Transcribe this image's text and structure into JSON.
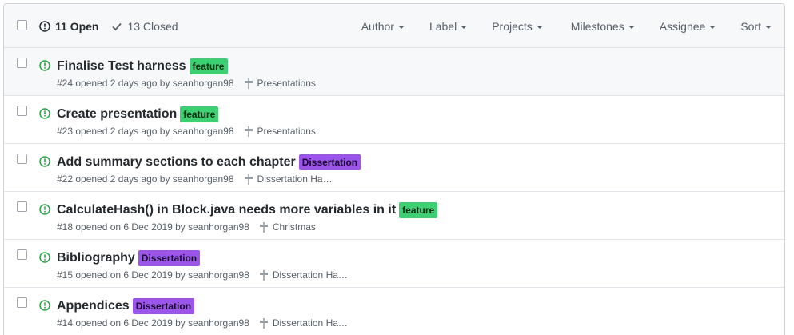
{
  "header": {
    "open_label": "11 Open",
    "closed_label": "13 Closed",
    "filters": [
      "Author",
      "Label",
      "Projects",
      "Milestones",
      "Assignee",
      "Sort"
    ]
  },
  "colors": {
    "open_icon": "#28a745",
    "feature": "#3ecf72",
    "dissertation": "#9b55e8"
  },
  "issues": [
    {
      "title": "Finalise Test harness",
      "label": "feature",
      "meta": "#24 opened 2 days ago by seanhorgan98",
      "milestone": "Presentations"
    },
    {
      "title": "Create presentation",
      "label": "feature",
      "meta": "#23 opened 2 days ago by seanhorgan98",
      "milestone": "Presentations"
    },
    {
      "title": "Add summary sections to each chapter",
      "label": "Dissertation",
      "meta": "#22 opened 2 days ago by seanhorgan98",
      "milestone": "Dissertation Ha…"
    },
    {
      "title": "CalculateHash() in Block.java needs more variables in it",
      "label": "feature",
      "meta": "#18 opened on 6 Dec 2019 by seanhorgan98",
      "milestone": "Christmas"
    },
    {
      "title": "Bibliography",
      "label": "Dissertation",
      "meta": "#15 opened on 6 Dec 2019 by seanhorgan98",
      "milestone": "Dissertation Ha…"
    },
    {
      "title": "Appendices",
      "label": "Dissertation",
      "meta": "#14 opened on 6 Dec 2019 by seanhorgan98",
      "milestone": "Dissertation Ha…"
    }
  ]
}
